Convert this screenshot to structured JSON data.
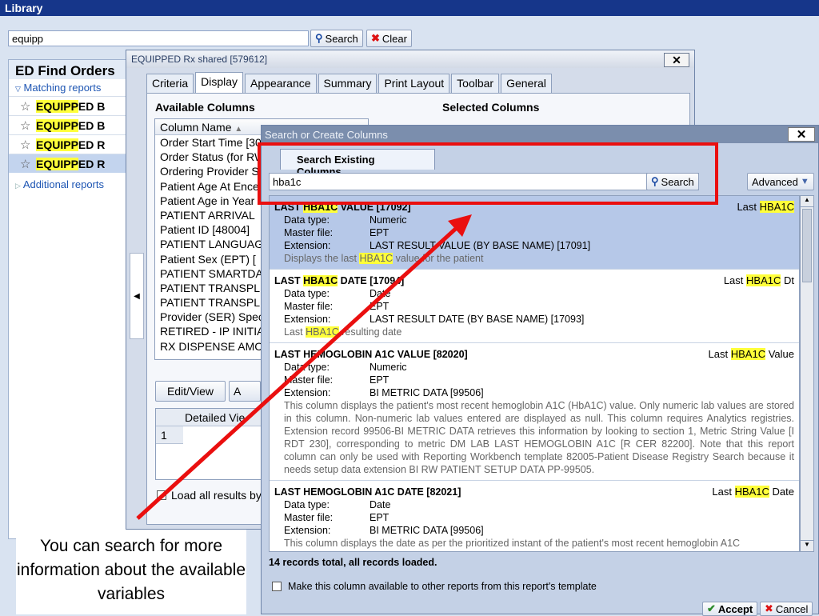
{
  "library": {
    "title": "Library",
    "search_value": "equipp",
    "search_label": "Search",
    "clear_label": "Clear"
  },
  "left_panel": {
    "title": "ED Find Orders",
    "matching_label": "Matching reports",
    "items": [
      {
        "hl": "EQUIPP",
        "rest": "ED B"
      },
      {
        "hl": "EQUIPP",
        "rest": "ED B"
      },
      {
        "hl": "EQUIPP",
        "rest": "ED R"
      },
      {
        "hl": "EQUIPP",
        "rest": "ED R"
      }
    ],
    "additional_label": "Additional reports"
  },
  "report_window": {
    "title": "EQUIPPED Rx shared [579612]",
    "tabs": [
      "Criteria",
      "Display",
      "Appearance",
      "Summary",
      "Print Layout",
      "Toolbar",
      "General"
    ],
    "available_columns_label": "Available Columns",
    "selected_columns_label": "Selected Columns",
    "column_header": "Column Name",
    "columns": [
      "Order Start Time [30",
      "Order Status (for RW",
      "Ordering Provider Sp",
      "Patient Age At Ence",
      "Patient Age in Year",
      "PATIENT ARRIVAL",
      "Patient ID [48004]",
      "PATIENT LANGUAG",
      "Patient Sex (EPT) [",
      "PATIENT SMARTDA",
      "PATIENT TRANSPL",
      "PATIENT TRANSPL",
      "Provider (SER) Spec",
      "RETIRED - IP INITIA",
      "RX DISPENSE AMC"
    ],
    "edit_view_label": "Edit/View",
    "detailed_view_label": "Detailed Vie",
    "grid_row": "1",
    "load_all_label": "Load all results by"
  },
  "search_window": {
    "title": "Search or Create Columns",
    "tab_label": "Search Existing Columns",
    "query": "hba1c",
    "search_label": "Search",
    "advanced_label": "Advanced",
    "records": [
      {
        "pre": "LAST ",
        "hl": "HBA1C",
        "post": " VALUE [17092]",
        "right_pre": "Last ",
        "right_hl": "HBA1C",
        "right_post": "",
        "data_type": "Numeric",
        "master_file": "EPT",
        "extension": "LAST RESULT VALUE (BY BASE NAME) [17091]",
        "desc_pre": "Displays the last ",
        "desc_hl": "HBA1C",
        "desc_post": " value for the patient"
      },
      {
        "pre": "LAST ",
        "hl": "HBA1C",
        "post": " DATE [17094]",
        "right_pre": "Last ",
        "right_hl": "HBA1C",
        "right_post": " Dt",
        "data_type": "Date",
        "master_file": "EPT",
        "extension": "LAST RESULT DATE (BY BASE NAME) [17093]",
        "desc_pre": "Last ",
        "desc_hl": "HBA1C",
        "desc_post": " resulting date"
      },
      {
        "pre": "LAST HEMOGLOBIN A1C VALUE [82020]",
        "hl": "",
        "post": "",
        "right_pre": "Last ",
        "right_hl": "HBA1C",
        "right_post": " Value",
        "data_type": "Numeric",
        "master_file": "EPT",
        "extension": "BI METRIC DATA [99506]",
        "desc_pre": "This column displays the patient's most recent hemoglobin A1C (HbA1C) value. Only numeric lab values are stored in this column. Non-numeric lab values entered are displayed as null. This column requires Analytics registries. Extension record 99506-BI METRIC DATA retrieves this information by looking to section 1, Metric String Value [I RDT 230], corresponding to metric DM LAB LAST HEMOGLOBIN A1C [R CER 82200]. Note that this report column can only be used with Reporting Workbench template 82005-Patient Disease Registry Search because it needs setup data extension BI RW PATIENT SETUP DATA PP-99505.",
        "desc_hl": "",
        "desc_post": ""
      },
      {
        "pre": "LAST HEMOGLOBIN A1C DATE [82021]",
        "hl": "",
        "post": "",
        "right_pre": "Last ",
        "right_hl": "HBA1C",
        "right_post": " Date",
        "data_type": "Date",
        "master_file": "EPT",
        "extension": "BI METRIC DATA [99506]",
        "desc_pre": "This column displays the date as per the prioritized instant of the patient's most recent hemoglobin A1C",
        "desc_hl": "",
        "desc_post": ""
      }
    ],
    "labels": {
      "data_type": "Data type:",
      "master_file": "Master file:",
      "extension": "Extension:"
    },
    "total": "14 records total, all records loaded.",
    "checkbox_label": "Make this column available to other reports from this report's template",
    "accept_label": "Accept",
    "cancel_label": "Cancel"
  },
  "annotation": {
    "text": "You can search for more information about the available variables",
    "arrow_color": "#ea0f0f"
  }
}
